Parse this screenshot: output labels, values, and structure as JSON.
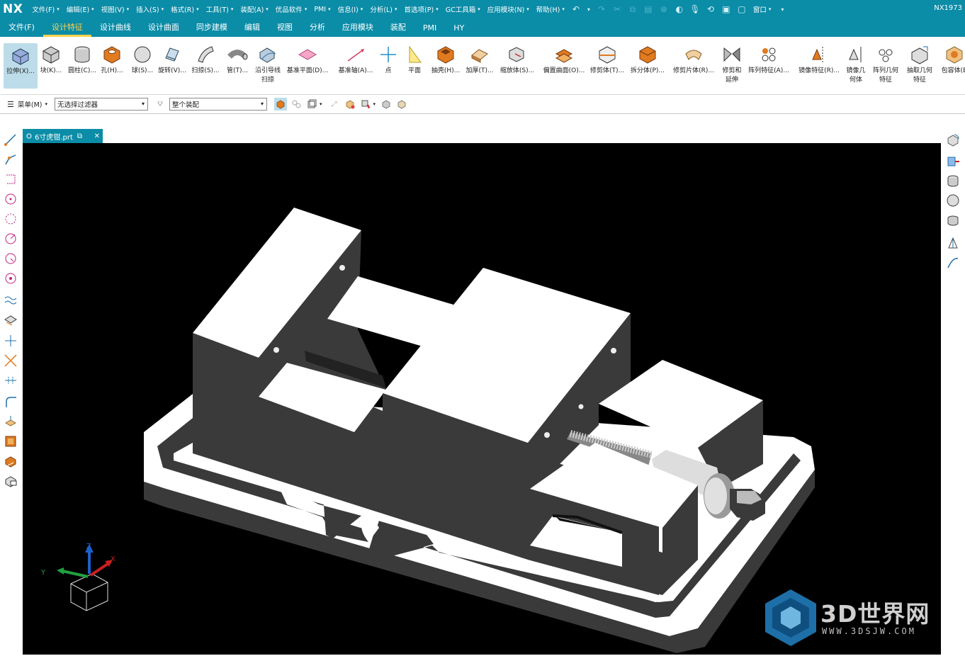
{
  "app": {
    "logo": "NX",
    "version": "NX1973"
  },
  "menubar": {
    "items": [
      {
        "label": "文件(F)",
        "has_caret": true
      },
      {
        "label": "编辑(E)",
        "has_caret": true
      },
      {
        "label": "视图(V)",
        "has_caret": true
      },
      {
        "label": "插入(S)",
        "has_caret": true
      },
      {
        "label": "格式(R)",
        "has_caret": true
      },
      {
        "label": "工具(T)",
        "has_caret": true
      },
      {
        "label": "装配(A)",
        "has_caret": true
      },
      {
        "label": "优品软件",
        "has_caret": true
      },
      {
        "label": "PMI",
        "has_caret": true
      },
      {
        "label": "信息(I)",
        "has_caret": true
      },
      {
        "label": "分析(L)",
        "has_caret": true
      },
      {
        "label": "首选项(P)",
        "has_caret": true
      },
      {
        "label": "GC工具箱",
        "has_caret": true
      },
      {
        "label": "应用模块(N)",
        "has_caret": true
      },
      {
        "label": "帮助(H)",
        "has_caret": true
      }
    ],
    "window_label": "窗口"
  },
  "ribbon_tabs": [
    {
      "label": "文件(F)",
      "active": false
    },
    {
      "label": "设计特征",
      "active": true
    },
    {
      "label": "设计曲线",
      "active": false
    },
    {
      "label": "设计曲面",
      "active": false
    },
    {
      "label": "同步建模",
      "active": false
    },
    {
      "label": "编辑",
      "active": false
    },
    {
      "label": "视图",
      "active": false
    },
    {
      "label": "分析",
      "active": false
    },
    {
      "label": "应用模块",
      "active": false
    },
    {
      "label": "装配",
      "active": false
    },
    {
      "label": "PMI",
      "active": false
    },
    {
      "label": "HY",
      "active": false
    }
  ],
  "ribbon_commands": [
    {
      "label": "拉伸(X)...",
      "icon": "extrude-icon"
    },
    {
      "label": "块(K)...",
      "icon": "block-icon"
    },
    {
      "label": "圆柱(C)...",
      "icon": "cylinder-icon"
    },
    {
      "label": "孔(H)...",
      "icon": "hole-icon"
    },
    {
      "label": "球(S)...",
      "icon": "sphere-icon"
    },
    {
      "label": "旋转(V)...",
      "icon": "revolve-icon"
    },
    {
      "label": "扫掠(S)...",
      "icon": "sweep-icon"
    },
    {
      "label": "管(T)...",
      "icon": "tube-icon"
    },
    {
      "label": "沿引导线",
      "label2": "扫掠",
      "icon": "sweep-guide-icon"
    },
    {
      "label": "基准平面(D)...",
      "icon": "datum-plane-icon"
    },
    {
      "label": "基准轴(A)...",
      "icon": "datum-axis-icon"
    },
    {
      "label": "点",
      "icon": "point-icon"
    },
    {
      "label": "平面",
      "icon": "plane-icon"
    },
    {
      "label": "抽壳(H)...",
      "icon": "shell-icon"
    },
    {
      "label": "加厚(T)...",
      "icon": "thicken-icon"
    },
    {
      "label": "缩放体(S)...",
      "icon": "scale-body-icon"
    },
    {
      "label": "偏置曲面(O)...",
      "icon": "offset-surface-icon"
    },
    {
      "label": "修剪体(T)...",
      "icon": "trim-body-icon"
    },
    {
      "label": "拆分体(P)...",
      "icon": "split-body-icon"
    },
    {
      "label": "修剪片体(R)...",
      "icon": "trim-sheet-icon"
    },
    {
      "label": "修剪和",
      "label2": "延伸",
      "icon": "trim-extend-icon"
    },
    {
      "label": "阵列特征(A)...",
      "icon": "pattern-feature-icon"
    },
    {
      "label": "镜像特征(R)...",
      "icon": "mirror-feature-icon"
    },
    {
      "label": "镜像几",
      "label2": "何体",
      "icon": "mirror-geometry-icon"
    },
    {
      "label": "阵列几何",
      "label2": "特征",
      "icon": "pattern-geometry-icon"
    },
    {
      "label": "抽取几何",
      "label2": "特征",
      "icon": "extract-geometry-icon"
    },
    {
      "label": "包容体(B",
      "icon": "bounding-body-icon"
    }
  ],
  "toolbar2": {
    "menu_label": "菜单(M)",
    "filter_value": "无选择过滤器",
    "scope_value": "整个装配"
  },
  "document_tab": {
    "title": "6寸虎钳.prt"
  },
  "triad": {
    "x_label": "X",
    "y_label": "Y",
    "z_label": "Z"
  },
  "watermark": {
    "title": "3D世界网",
    "url": "WWW.3DSJW.COM"
  },
  "colors": {
    "header_teal": "#0b8ca7",
    "active_tab": "#ffd24a",
    "viewport_bg": "#000000",
    "model_light": "#ffffff",
    "model_dark": "#3a3a3a"
  }
}
